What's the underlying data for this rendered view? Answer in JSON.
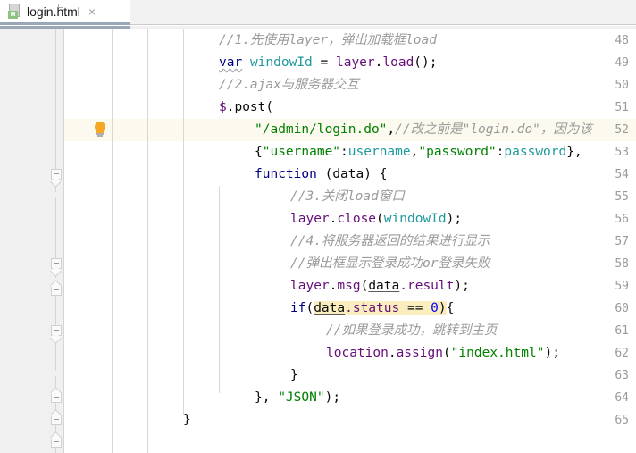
{
  "tab": {
    "label": "login.html",
    "close_label": "×",
    "icon": "html-file-icon",
    "badge": "H"
  },
  "editor": {
    "gutter_icon": "lightbulb-intention-icon",
    "caret_line": 52,
    "first_visible_line": 48,
    "last_visible_line": 65,
    "highlight_color": "#faeebe",
    "caret_line_color": "#fcfaef",
    "line_numbers": [
      48,
      49,
      50,
      51,
      52,
      53,
      54,
      55,
      56,
      57,
      58,
      59,
      60,
      61,
      62,
      63,
      64,
      65
    ],
    "fold_markers": [
      {
        "line": 54,
        "type": "region-start"
      },
      {
        "line": 57,
        "type": "region-start"
      },
      {
        "line": 58,
        "type": "region-end"
      },
      {
        "line": 60,
        "type": "region-start"
      },
      {
        "line": 63,
        "type": "region-end"
      },
      {
        "line": 64,
        "type": "region-end"
      },
      {
        "line": 65,
        "type": "region-end"
      }
    ],
    "lines": [
      {
        "n": 48,
        "text": "            //1.先使用layer，弹出加载框load"
      },
      {
        "n": 49,
        "text": "            var windowId = layer.load();"
      },
      {
        "n": 50,
        "text": "            //2.ajax与服务器交互"
      },
      {
        "n": 51,
        "text": "            $.post("
      },
      {
        "n": 52,
        "text": "                \"/admin/login.do\",//改之前是\"login.do\"，因为该"
      },
      {
        "n": 53,
        "text": "                {\"username\":username,\"password\":password},"
      },
      {
        "n": 54,
        "text": "                function (data) {"
      },
      {
        "n": 55,
        "text": "                    //3.关闭load窗口"
      },
      {
        "n": 56,
        "text": "                    layer.close(windowId);"
      },
      {
        "n": 57,
        "text": "                    //4.将服务器返回的结果进行显示"
      },
      {
        "n": 58,
        "text": "                    //弹出框显示登录成功or登录失败"
      },
      {
        "n": 59,
        "text": "                    layer.msg(data.result);"
      },
      {
        "n": 60,
        "text": "                    if(data.status == 0){"
      },
      {
        "n": 61,
        "text": "                        //如果登录成功，跳转到主页"
      },
      {
        "n": 62,
        "text": "                        location.assign(\"index.html\");"
      },
      {
        "n": 63,
        "text": "                    }"
      },
      {
        "n": 64,
        "text": "                }, \"JSON\");"
      },
      {
        "n": 65,
        "text": "        }"
      }
    ],
    "tokens": {
      "l48_comment": "//1.先使用layer，弹出加载框load",
      "l49_kw": "var",
      "l49_var": "windowId",
      "l49_eq": " = ",
      "l49_obj": "layer",
      "l49_dot": ".",
      "l49_call": "load",
      "l49_tail": "();",
      "l50_comment": "//2.ajax与服务器交互",
      "l51_dollar": "$",
      "l51_post": ".post(",
      "l52_str": "\"/admin/login.do\"",
      "l52_comma": ",",
      "l52_comment": "//改之前是\"login.do\"，因为该",
      "l53_brace": "{",
      "l53_key1": "\"username\"",
      "l53_colon1": ":",
      "l53_val1": "username",
      "l53_comma": ",",
      "l53_key2": "\"password\"",
      "l53_colon2": ":",
      "l53_val2": "password",
      "l53_tail": "},",
      "l54_kw": "function",
      "l54_open": " (",
      "l54_param": "data",
      "l54_close": ") {",
      "l55_comment": "//3.关闭load窗口",
      "l56_obj": "layer",
      "l56_dot": ".",
      "l56_call": "close",
      "l56_p1": "(",
      "l56_arg": "windowId",
      "l56_p2": ");",
      "l57_comment": "//4.将服务器返回的结果进行显示",
      "l58_comment": "//弹出框显示登录成功or登录失败",
      "l59_obj": "layer",
      "l59_dot": ".",
      "l59_call": "msg",
      "l59_p1": "(",
      "l59_arg": "data",
      "l59_prop": ".result",
      "l59_p2": ");",
      "l60_kw": "if",
      "l60_p1": "(",
      "l60_arg": "data",
      "l60_prop": ".status",
      "l60_op": " == ",
      "l60_num": "0",
      "l60_p2": ")",
      "l60_brace": "{",
      "l61_comment": "//如果登录成功，跳转到主页",
      "l62_obj": "location",
      "l62_dot": ".",
      "l62_call": "assign",
      "l62_p1": "(",
      "l62_str": "\"index.html\"",
      "l62_p2": ");",
      "l63_brace": "}",
      "l64_head": "}, ",
      "l64_str": "\"JSON\"",
      "l64_tail": ");",
      "l65_brace": "}"
    }
  }
}
